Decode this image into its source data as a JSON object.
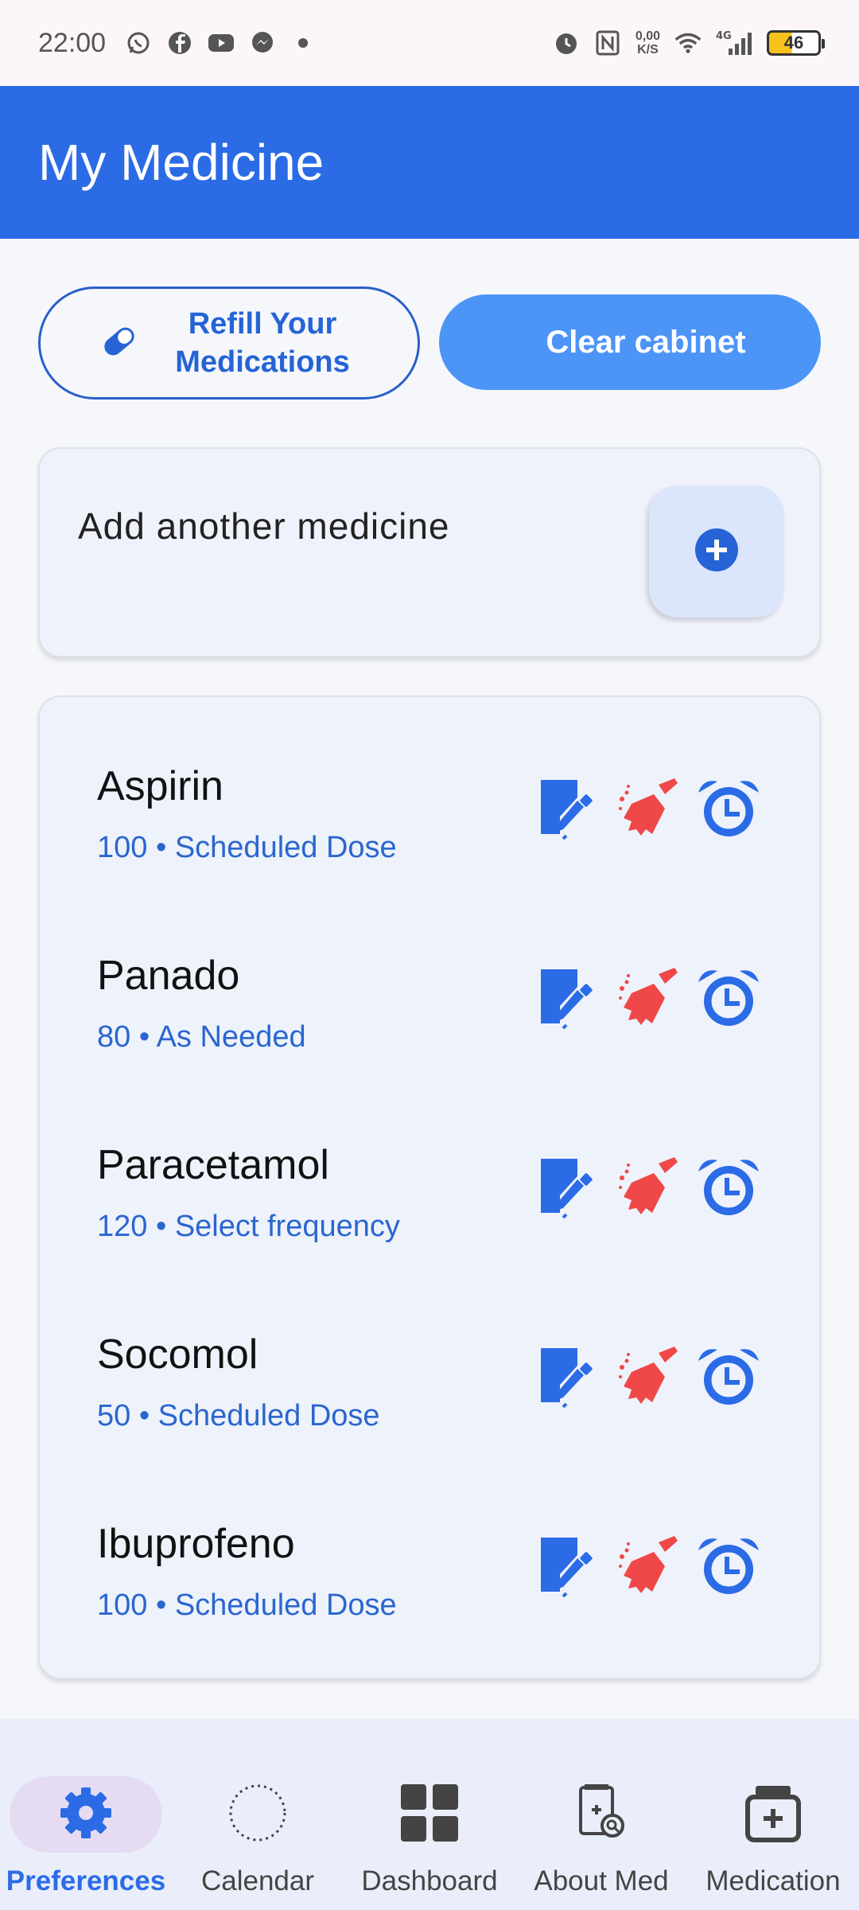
{
  "status_bar": {
    "time": "22:00",
    "net_speed_top": "0,00",
    "net_speed_bottom": "K/S",
    "network": "4G",
    "battery": "46",
    "icons": [
      "whatsapp-icon",
      "facebook-icon",
      "youtube-icon",
      "messenger-icon",
      "alarm-icon",
      "nfc-icon",
      "wifi-icon",
      "signal-icon"
    ]
  },
  "app_bar": {
    "title": "My Medicine"
  },
  "actions": {
    "refill_label": "Refill Your\nMedications",
    "clear_label": "Clear cabinet"
  },
  "add_card": {
    "label": "Add another medicine"
  },
  "medicines": [
    {
      "name": "Aspirin",
      "subtitle": "100 • Scheduled Dose"
    },
    {
      "name": "Panado",
      "subtitle": "80 • As Needed"
    },
    {
      "name": "Paracetamol",
      "subtitle": "120 • Select frequency"
    },
    {
      "name": "Socomol",
      "subtitle": "50 • Scheduled Dose"
    },
    {
      "name": "Ibuprofeno",
      "subtitle": "100 • Scheduled Dose"
    }
  ],
  "nav": {
    "items": [
      {
        "label": "Preferences",
        "icon": "gear-icon",
        "active": true
      },
      {
        "label": "Calendar",
        "icon": "dotted-circle-icon",
        "active": false
      },
      {
        "label": "Dashboard",
        "icon": "dashboard-icon",
        "active": false
      },
      {
        "label": "About Med",
        "icon": "about-med-icon",
        "active": false
      },
      {
        "label": "Medication",
        "icon": "medicine-box-icon",
        "active": false
      }
    ]
  },
  "colors": {
    "primary": "#2b6be6",
    "button_fill": "#4d94f7",
    "subtitle": "#2a66cf",
    "delete_red": "#f04848",
    "nav_active_pill": "#e5dcf3"
  }
}
